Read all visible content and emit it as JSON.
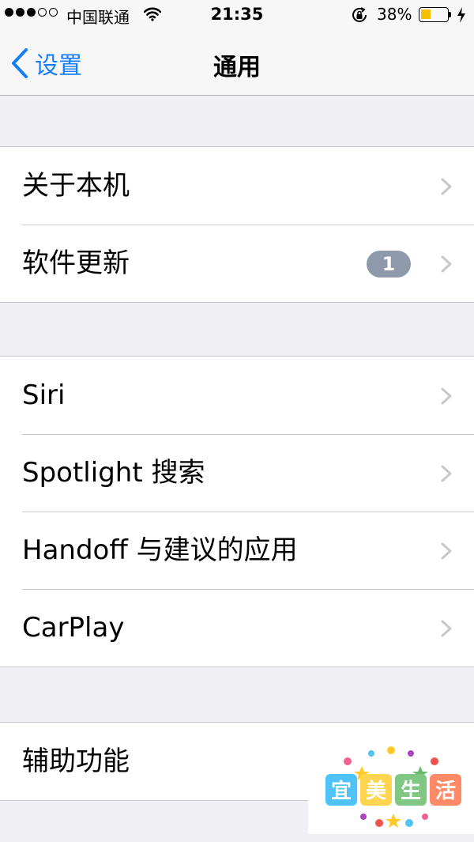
{
  "status_bar": {
    "carrier": "中国联通",
    "time": "21:35",
    "battery_percent": "38%",
    "battery_level": 0.38,
    "signal_bars_filled": 3,
    "signal_bars_total": 5,
    "icons": [
      "signal-icon",
      "wifi-icon",
      "orientation-lock-icon",
      "battery-icon",
      "charging-icon"
    ]
  },
  "nav": {
    "back_label": "设置",
    "title": "通用",
    "accent_color": "#147efb"
  },
  "groups": [
    {
      "items": [
        {
          "label": "关于本机"
        },
        {
          "label": "软件更新",
          "badge": "1"
        }
      ]
    },
    {
      "items": [
        {
          "label": "Siri"
        },
        {
          "label": "Spotlight 搜索"
        },
        {
          "label": "Handoff 与建议的应用"
        },
        {
          "label": "CarPlay"
        }
      ]
    },
    {
      "items": [
        {
          "label": "辅助功能"
        }
      ]
    }
  ],
  "watermark": {
    "text": "宜美生活"
  }
}
